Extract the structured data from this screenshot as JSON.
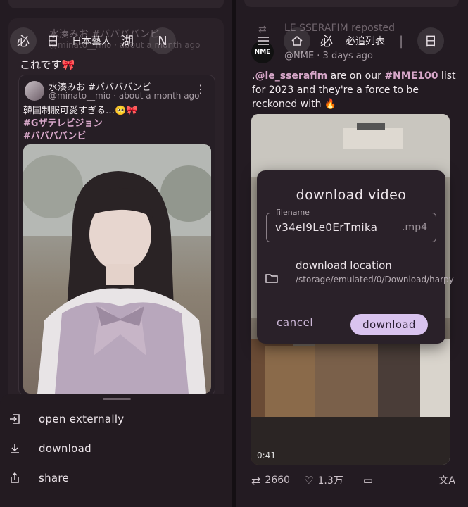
{
  "left": {
    "faded_author": "水湊みお #ババババンビ",
    "faded_handle": "@minato__mio · about a month ago",
    "toolbar": {
      "btn1": "必",
      "btn2": "日",
      "btn2_text": "日本藝人",
      "btn3": "湖",
      "btn4": "N"
    },
    "post_text": "これです🎀",
    "quote": {
      "name": "水湊みお #ババババンビ",
      "handle": "@minato__mio · about a month ago",
      "text": "韓国制服可愛すぎる…🥺🎀",
      "tags": [
        "#Gザテレビジョン",
        "#ババババンビ"
      ],
      "more": "⋮"
    },
    "sheet": {
      "items": [
        {
          "label": "open externally",
          "icon": "open-external-icon"
        },
        {
          "label": "download",
          "icon": "download-icon"
        },
        {
          "label": "share",
          "icon": "share-icon"
        }
      ]
    }
  },
  "right": {
    "repost_text": "LE SSERAFIM reposted",
    "author": "NME",
    "handle": "@NME · 3 days ago",
    "toolbar": {
      "btn2": "必",
      "btn2_text": "必追列表",
      "btn3": "|",
      "btn4": "日"
    },
    "text_parts": {
      "p1": ".",
      "mention": "@le_sserafim",
      "p2": " are on our ",
      "hashtag": "#NME100",
      "p3": " list for 2023 and they're a force to be reckoned with 🔥"
    },
    "video_time": "0:41",
    "actions": {
      "reposts": "2660",
      "likes": "1.3万"
    },
    "dialog": {
      "title": "download video",
      "filename_label": "filename",
      "filename_value": "v34el9Le0ErTmika",
      "filename_suffix": ".mp4",
      "location_title": "download location",
      "location_path": "/storage/emulated/0/Download/harpy",
      "cancel": "cancel",
      "download": "download"
    }
  }
}
